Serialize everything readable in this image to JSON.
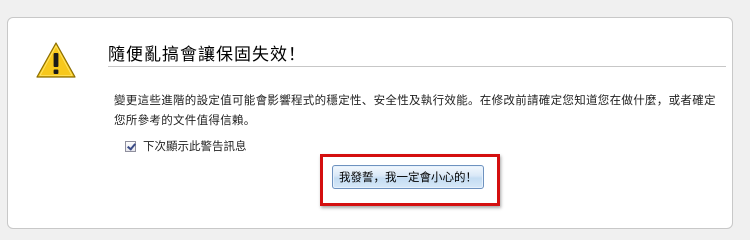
{
  "warning": {
    "title": "隨便亂搞會讓保固失效！",
    "description": "變更這些進階的設定值可能會影響程式的穩定性、安全性及執行效能。在修改前請確定您知道您在做什麼，或者確定您所參考的文件值得信賴。",
    "checkbox_label": "下次顯示此警告訊息",
    "checkbox_checked": true,
    "confirm_button_label": "我發誓，我一定會小心的！"
  },
  "colors": {
    "icon_fill": "#f7c81c",
    "highlight_border": "#d40f0f"
  },
  "icons": {
    "warning": "warning-triangle-icon",
    "checkbox": "checkbox-checked-icon"
  }
}
